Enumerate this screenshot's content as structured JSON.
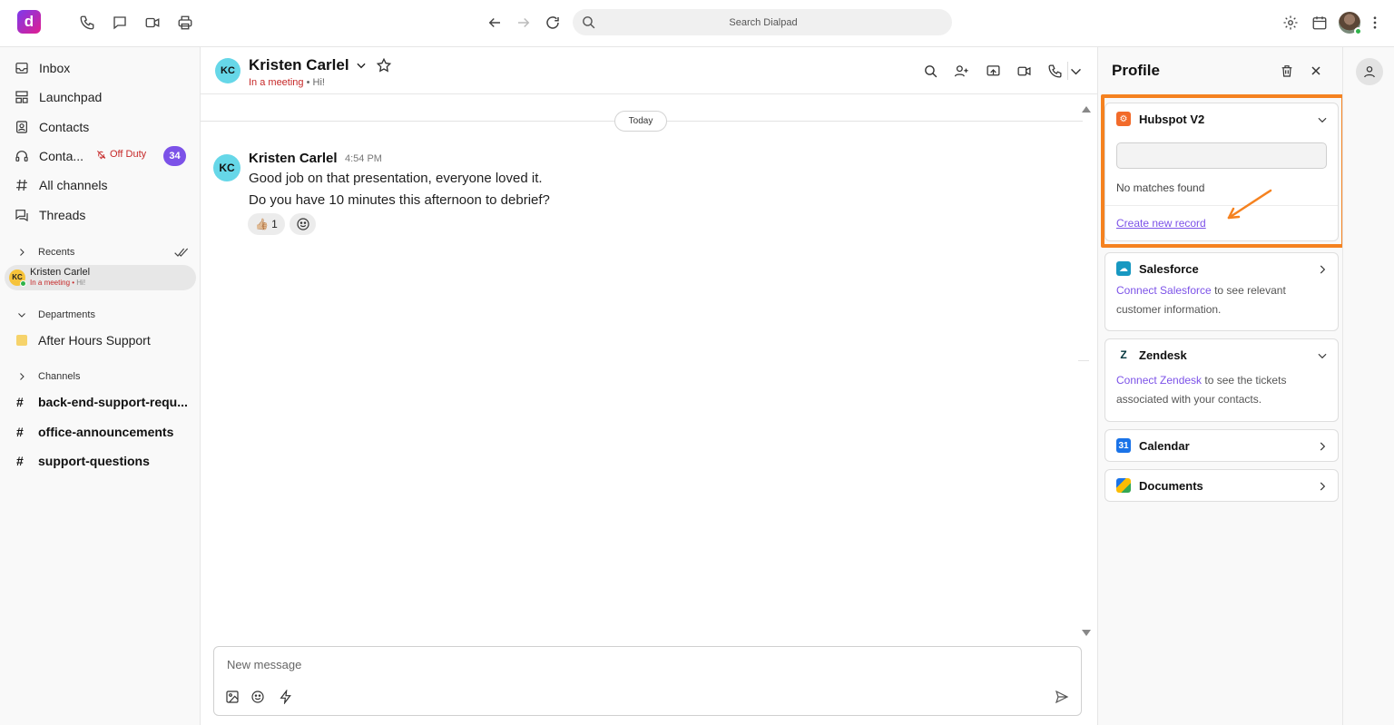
{
  "app": {
    "logo_letter": "d",
    "brand_color": "#7c52e8"
  },
  "topbar": {
    "search_placeholder": "Search Dialpad",
    "icons": [
      "phone-icon",
      "chat-icon",
      "video-icon",
      "print-icon",
      "back-icon",
      "forward-icon",
      "refresh-icon",
      "settings-icon",
      "calendar-icon",
      "more-icon"
    ]
  },
  "sidebar": {
    "nav": [
      {
        "label": "Inbox",
        "icon": "inbox-icon"
      },
      {
        "label": "Launchpad",
        "icon": "launchpad-icon"
      },
      {
        "label": "Contacts",
        "icon": "contacts-icon"
      },
      {
        "label": "Conta...",
        "icon": "headset-icon"
      },
      {
        "label": "All channels",
        "icon": "hash-icon"
      },
      {
        "label": "Threads",
        "icon": "threads-icon"
      }
    ],
    "contact_center_status": "Off Duty",
    "contact_center_count": "34",
    "recents_label": "Recents",
    "recent": {
      "initials": "KC",
      "name": "Kristen Carlel",
      "status": "In a meeting",
      "preview": "Hi!"
    },
    "departments_label": "Departments",
    "department": "After Hours Support",
    "channels_label": "Channels",
    "channels": [
      "back-end-support-requ...",
      "office-announcements",
      "support-questions"
    ]
  },
  "conversation": {
    "initials": "KC",
    "name": "Kristen Carlel",
    "status": "In a meeting",
    "status_preview": "Hi!",
    "day_label": "Today",
    "message": {
      "author": "Kristen Carlel",
      "time": "4:54 PM",
      "lines": [
        "Good job on that presentation, everyone loved it.",
        "Do you have 10 minutes this afternoon to debrief?"
      ],
      "reaction_emoji": "👍🏼",
      "reaction_count": "1"
    },
    "composer_placeholder": "New message"
  },
  "profile": {
    "title": "Profile",
    "cards": {
      "hubspot": {
        "title": "Hubspot V2",
        "no_matches": "No matches found",
        "create_link": "Create new record",
        "color": "#f26b2a"
      },
      "salesforce": {
        "title": "Salesforce",
        "link": "Connect Salesforce",
        "rest": " to see relevant customer information.",
        "color": "#1798c1"
      },
      "zendesk": {
        "title": "Zendesk",
        "link": "Connect Zendesk",
        "rest": " to see the tickets associated with your contacts.",
        "color": "#03363d"
      },
      "calendar": {
        "title": "Calendar",
        "color": "#1a73e8"
      },
      "documents": {
        "title": "Documents",
        "color": "#fbbc04"
      }
    },
    "highlight_color": "#f58220"
  }
}
